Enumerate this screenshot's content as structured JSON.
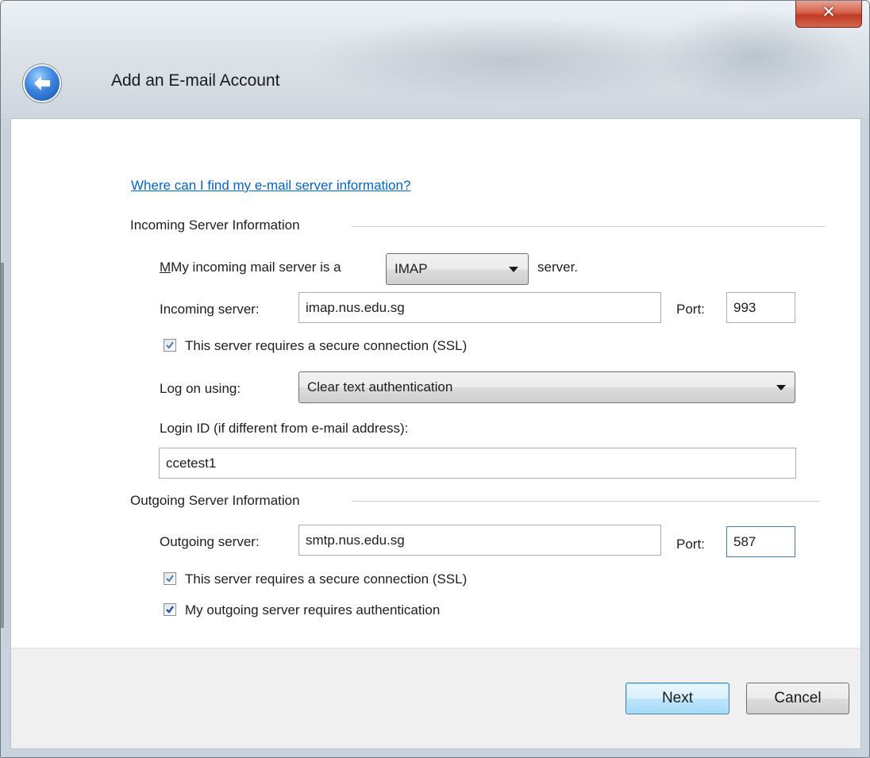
{
  "window": {
    "title": "Add an E-mail Account",
    "close_glyph": "✕"
  },
  "help_link": "Where can I find my e-mail server information?",
  "incoming": {
    "group_label": "Incoming Server Information",
    "server_type_prefix": "My incoming mail server is a",
    "server_type_value": "IMAP",
    "server_type_suffix": "server.",
    "server_label": "Incoming server:",
    "server_value": "imap.nus.edu.sg",
    "port_label": "Port:",
    "port_value": "993",
    "ssl_label": "This server requires a secure connection (SSL)",
    "ssl_checked": true,
    "logon_label": "Log on using:",
    "logon_value": "Clear text authentication",
    "login_id_label": "Login ID (if different from e-mail address):",
    "login_id_value": "ccetest1"
  },
  "outgoing": {
    "group_label": "Outgoing Server Information",
    "server_label": "Outgoing server:",
    "server_value": "smtp.nus.edu.sg",
    "port_label": "Port:",
    "port_value": "587",
    "ssl_label": "This server requires a secure connection (SSL)",
    "ssl_checked": true,
    "auth_label": "My outgoing server requires authentication",
    "auth_checked": true
  },
  "buttons": {
    "next": "Next",
    "cancel": "Cancel"
  },
  "icons": {
    "back": "back-arrow-icon",
    "close": "close-icon",
    "checkbox": "checkmark-icon",
    "dropdown": "chevron-down-icon"
  }
}
